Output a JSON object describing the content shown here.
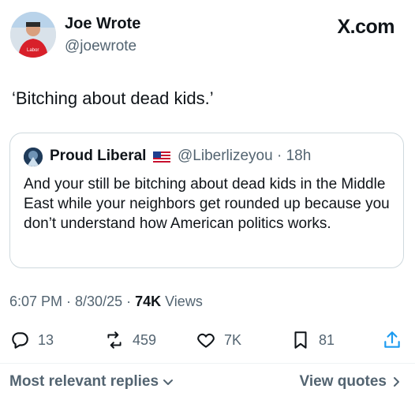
{
  "header": {
    "display_name": "Joe Wrote",
    "handle": "@joewrote",
    "brand": "X.com",
    "avatar_badge": "Labor"
  },
  "tweet": {
    "text": "‘Bitching about dead kids.’"
  },
  "quoted": {
    "display_name": "Proud Liberal",
    "handle_time": "@Liberlizeyou · 18h",
    "text": "And your still be bitching about dead kids in the Middle East while your neighbors get rounded up because you don’t understand how American politics works."
  },
  "meta": {
    "timestamp": "6:07 PM · 8/30/25 · ",
    "views_count": "74K",
    "views_label": " Views"
  },
  "actions": {
    "replies": "13",
    "reposts": "459",
    "likes": "7K",
    "bookmarks": "81"
  },
  "footer": {
    "sort_label": "Most relevant replies",
    "view_quotes": "View quotes"
  },
  "colors": {
    "text": "#0f1419",
    "secondary": "#536471",
    "border": "#cfd9de"
  }
}
